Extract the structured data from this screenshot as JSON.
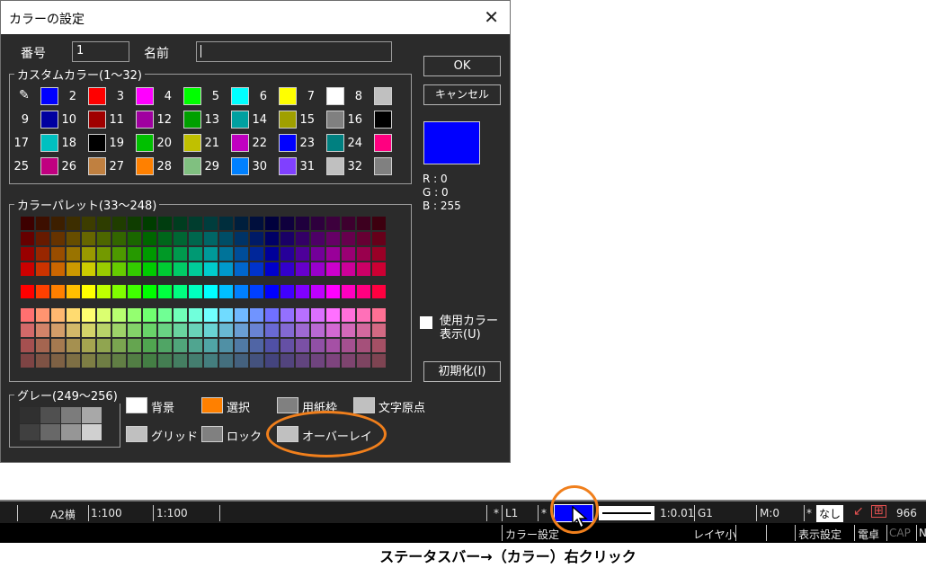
{
  "dialog": {
    "title": "カラーの設定",
    "close_glyph": "✕",
    "number_label": "番号",
    "number_value": "1",
    "name_label": "名前",
    "name_value": "",
    "ok_label": "OK",
    "cancel_label": "キャンセル",
    "custom_group_label": "カスタムカラー(1～32)",
    "palette_group_label": "カラーパレット(33～248)",
    "gray_group_label": "グレー(249～256)",
    "rgb": {
      "r": "R : 0",
      "g": "G : 0",
      "b": "B : 255"
    },
    "preview_color": "#0000ff",
    "used_color_label_1": "使用カラー",
    "used_color_label_2": "表示(U)",
    "init_label": "初期化(I)",
    "custom_colors": [
      {
        "n": "",
        "c": "#0000ff"
      },
      {
        "n": "2",
        "c": "#ff0000"
      },
      {
        "n": "3",
        "c": "#ff00ff"
      },
      {
        "n": "4",
        "c": "#00ff00"
      },
      {
        "n": "5",
        "c": "#00ffff"
      },
      {
        "n": "6",
        "c": "#ffff00"
      },
      {
        "n": "7",
        "c": "#ffffff"
      },
      {
        "n": "8",
        "c": "#c0c0c0"
      },
      {
        "n": "9",
        "c": "#0000a0"
      },
      {
        "n": "10",
        "c": "#a00000"
      },
      {
        "n": "11",
        "c": "#a000a0"
      },
      {
        "n": "12",
        "c": "#00a000"
      },
      {
        "n": "13",
        "c": "#00a0a0"
      },
      {
        "n": "14",
        "c": "#a0a000"
      },
      {
        "n": "15",
        "c": "#808080"
      },
      {
        "n": "16",
        "c": "#000000"
      },
      {
        "n": "17",
        "c": "#00c0c0"
      },
      {
        "n": "18",
        "c": "#000000"
      },
      {
        "n": "19",
        "c": "#00c000"
      },
      {
        "n": "20",
        "c": "#c0c000"
      },
      {
        "n": "21",
        "c": "#c000c0"
      },
      {
        "n": "22",
        "c": "#0000ff"
      },
      {
        "n": "23",
        "c": "#008080"
      },
      {
        "n": "24",
        "c": "#ff0080"
      },
      {
        "n": "25",
        "c": "#c00080"
      },
      {
        "n": "26",
        "c": "#c08040"
      },
      {
        "n": "27",
        "c": "#ff8000"
      },
      {
        "n": "28",
        "c": "#80c080"
      },
      {
        "n": "29",
        "c": "#0080ff"
      },
      {
        "n": "30",
        "c": "#8040ff"
      },
      {
        "n": "31",
        "c": "#c0c0c0"
      },
      {
        "n": "32",
        "c": "#808080"
      }
    ],
    "gray_colors": [
      "#303030",
      "#505050",
      "#7c7c7c",
      "#a8a8a8",
      "#404040",
      "#686868",
      "#969696",
      "#d0d0d0"
    ],
    "specials": [
      {
        "label": "背景",
        "c": "#ffffff"
      },
      {
        "label": "選択",
        "c": "#ff8000"
      },
      {
        "label": "用紙枠",
        "c": "#808080"
      },
      {
        "label": "文字原点",
        "c": "#c0c0c0"
      },
      {
        "label": "グリッド",
        "c": "#c0c0c0"
      },
      {
        "label": "ロック",
        "c": "#808080"
      },
      {
        "label": "オーバーレイ",
        "c": "#c0c0c0"
      }
    ]
  },
  "statusbar": {
    "paper": "A2横",
    "scale1": "1:100",
    "scale2": "1:100",
    "star1": "*",
    "layer": "L1",
    "star2": "*",
    "color_setting": "カラー設定",
    "line_scale": "1:0.01",
    "group": "G1",
    "mode": "M:0",
    "star3": "*",
    "nashi": "なし",
    "count": "966",
    "layer_small": "レイヤ小",
    "display_setting": "表示設定",
    "calculator": "電卓",
    "cap": "CAP",
    "n": "N",
    "current_color": "#0000ff"
  },
  "caption": "ステータスバー→（カラー）右クリック",
  "accent": "#f07f1c"
}
